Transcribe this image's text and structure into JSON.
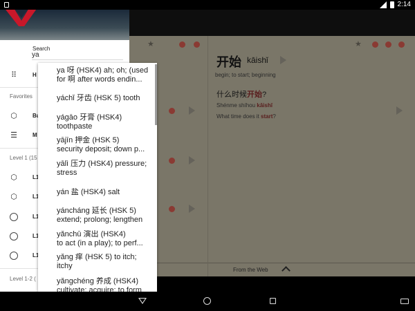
{
  "statusbar": {
    "time": "2:14"
  },
  "drawer": {
    "search_label": "Search",
    "search_value": "ya",
    "rows": [
      {
        "icon": "grid-icon",
        "label": "H"
      },
      {
        "icon": "box-icon",
        "label": "Bu"
      },
      {
        "icon": "checklist-icon",
        "label": "M"
      }
    ],
    "favorites_header": "Favorites",
    "level1_header": "Level 1 (15",
    "level1_items": [
      "L1",
      "L1",
      "L1",
      "L1",
      "L1"
    ],
    "level12_header": "Level 1-2 ("
  },
  "autocomplete": {
    "items": [
      {
        "line1": "ya 呀 (HSK4) ah; oh; (used",
        "line2": "for 啊 after words endin..."
      },
      {
        "line1": "yáchǐ 牙齿 (HSK 5) tooth",
        "line2": ""
      },
      {
        "line1": "yágāo 牙膏 (HSK4)",
        "line2": "toothpaste"
      },
      {
        "line1": "yājīn 押金 (HSK 5)",
        "line2": "security deposit; down p..."
      },
      {
        "line1": "yālì 压力 (HSK4) pressure;",
        "line2": "stress"
      },
      {
        "line1": "yán 盐 (HSK4) salt",
        "line2": ""
      },
      {
        "line1": "yáncháng 延长 (HSK 5)",
        "line2": "extend; prolong; lengthen"
      },
      {
        "line1": "yǎnchū 演出 (HSK4)",
        "line2": "to act (in a play); to perf..."
      },
      {
        "line1": "yǎng 痒 (HSK 5) to itch;",
        "line2": "itchy"
      },
      {
        "line1": "yǎngchéng 养成 (HSK4)",
        "line2": "cultivate; acquire; to form"
      }
    ]
  },
  "card": {
    "word": "开始",
    "pinyin": "kāishǐ",
    "gloss": "begin; to start; beginning",
    "question_cn_before": "什么时候",
    "question_cn_highlight": "开始",
    "question_cn_after": "?",
    "question_py_before": "Shénme shíhou ",
    "question_py_highlight": "kāishǐ",
    "question_en_before": "What time does it ",
    "question_en_highlight": "start",
    "question_en_after": "?",
    "from_web": "From the Web"
  },
  "colors": {
    "accent": "#591e1e",
    "overlay_pane": "#7a7668",
    "red_icon": "#8a3a33"
  }
}
